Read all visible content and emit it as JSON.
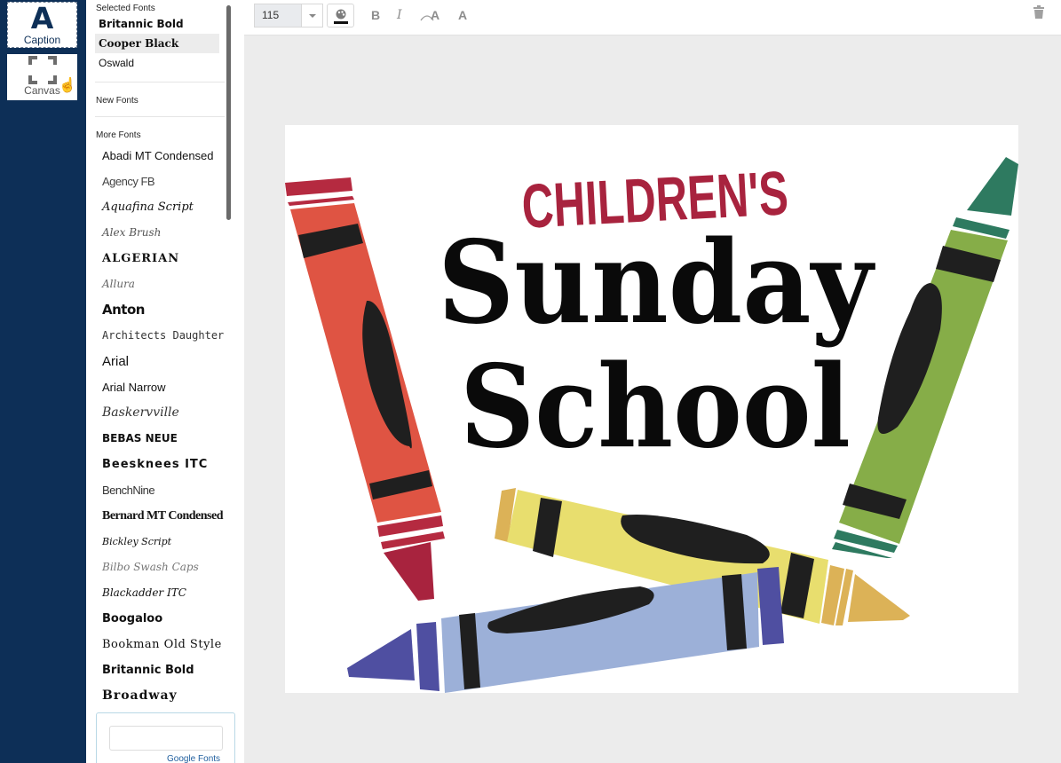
{
  "rail": {
    "caption_label": "Caption",
    "caption_icon": "A",
    "canvas_label": "Canvas"
  },
  "font_panel": {
    "selected_title": "Selected Fonts",
    "selected_fonts": [
      "Britannic Bold",
      "Cooper Black",
      "Oswald"
    ],
    "active_font": "Cooper Black",
    "new_title": "New Fonts",
    "more_title": "More Fonts",
    "more_fonts": [
      "Abadi MT Condensed",
      "Agency FB",
      "Aquafina Script",
      "Alex Brush",
      "ALGERIAN",
      "Allura",
      "Anton",
      "Architects Daughter",
      "Arial",
      "Arial Narrow",
      "Baskervville",
      "BEBAS NEUE",
      "Beesknees ITC",
      "BenchNine",
      "Bernard MT Condensed",
      "Bickley Script",
      "Bilbo Swash Caps",
      "Blackadder ITC",
      "Boogaloo",
      "Bookman Old Style",
      "Britannic Bold",
      "Broadway"
    ],
    "google_fonts_link": "Google Fonts",
    "google_fonts_input": ""
  },
  "toolbar": {
    "font_size": "115",
    "bold_label": "B",
    "italic_label": "I",
    "curve_label": "A",
    "shadow_label": "A"
  },
  "canvas": {
    "headline_small": "CHILDREN'S",
    "headline_line1": "Sunday",
    "headline_line2": "School"
  },
  "colors": {
    "rail_bg": "#0d2f57",
    "headline_small": "#a8233e",
    "crayon_red": "#df5443",
    "crayon_green": "#86ad48",
    "crayon_yellow": "#e8de6e",
    "crayon_blue": "#9cb0d8"
  }
}
